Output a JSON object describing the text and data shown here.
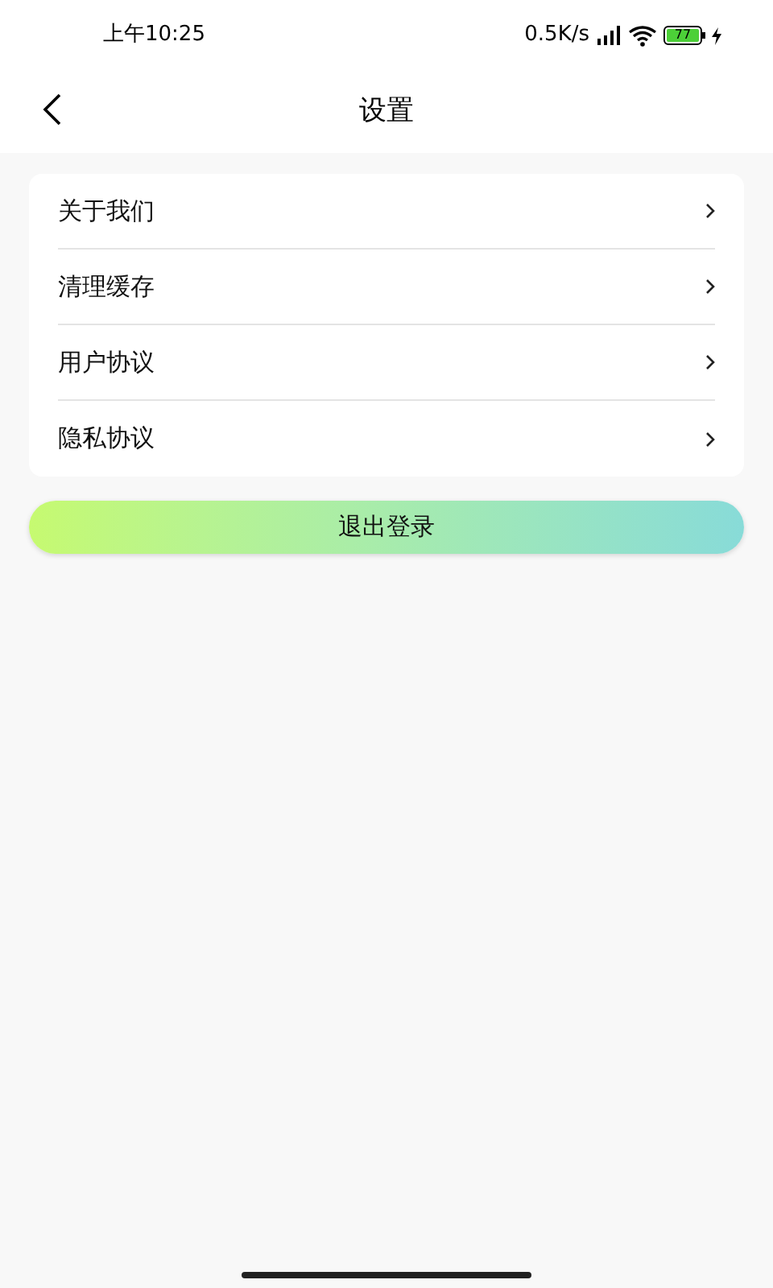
{
  "status_bar": {
    "time": "上午10:25",
    "speed": "0.5K/s",
    "battery": "77"
  },
  "header": {
    "title": "设置"
  },
  "menu": [
    {
      "label": "关于我们"
    },
    {
      "label": "清理缓存"
    },
    {
      "label": "用户协议"
    },
    {
      "label": "隐私协议"
    }
  ],
  "logout_button": "退出登录"
}
